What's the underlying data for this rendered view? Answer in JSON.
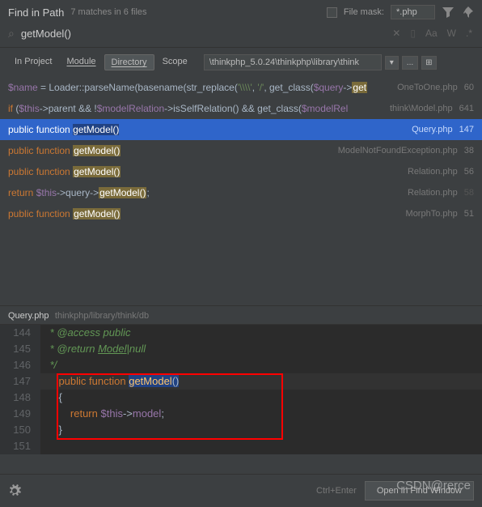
{
  "header": {
    "title": "Find in Path",
    "subtitle": "7 matches in 6 files",
    "filemask_label": "File mask:",
    "filemask_value": "*.php"
  },
  "search": {
    "value": "getModel()",
    "case_label": "Aa",
    "word_label": "W",
    "regex_label": ".*"
  },
  "scope": {
    "tabs": [
      "In Project",
      "Module",
      "Directory",
      "Scope"
    ],
    "active_index": 2,
    "path": "\\thinkphp_5.0.24\\thinkphp\\library\\think"
  },
  "results": [
    {
      "file": "OneToOne.php",
      "line": "60"
    },
    {
      "file": "think\\Model.php",
      "line": "641"
    },
    {
      "file": "Query.php",
      "line": "147"
    },
    {
      "file": "ModelNotFoundException.php",
      "line": "38"
    },
    {
      "file": "Relation.php",
      "line": "56"
    },
    {
      "file": "Relation.php",
      "line": "58"
    },
    {
      "file": "MorphTo.php",
      "line": "51"
    }
  ],
  "preview": {
    "file": "Query.php",
    "path": "thinkphp/library/think/db",
    "lines": {
      "144": "144",
      "145": "145",
      "146": "146",
      "147": "147",
      "148": "148",
      "149": "149",
      "150": "150",
      "151": "151"
    },
    "doc_access": " * @access public",
    "doc_return1": " * ",
    "doc_return2": "@return",
    "doc_model": "Model",
    "doc_null": "|null",
    "doc_end": " */",
    "kw_public": "public",
    "kw_function": "function",
    "fn_name": "getModel",
    "parens": "()",
    "brace_o": "{",
    "kw_return": "return",
    "this": "$this",
    "arrow": "->",
    "prop": "model",
    "semi": ";",
    "brace_c": "}"
  },
  "footer": {
    "hint": "Ctrl+Enter",
    "button": "Open in Find Window"
  },
  "watermark": "CSDN@rerce"
}
